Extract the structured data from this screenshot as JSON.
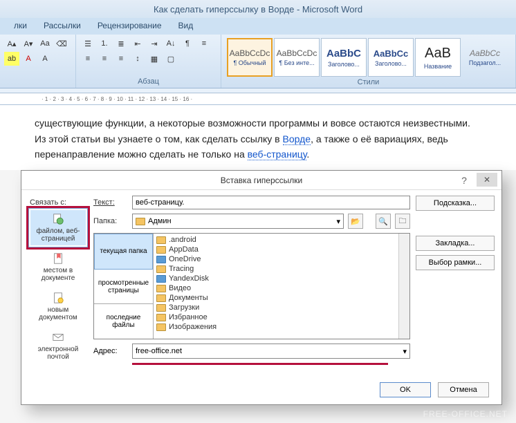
{
  "window": {
    "title": "Как сделать гиперссылку в Ворде - Microsoft Word"
  },
  "tabs": {
    "t1": "лки",
    "t2": "Рассылки",
    "t3": "Рецензирование",
    "t4": "Вид"
  },
  "ribbon": {
    "para_label": "Абзац",
    "styles_label": "Стили",
    "styles": [
      {
        "preview": "AaBbCcDc",
        "name": "¶ Обычный"
      },
      {
        "preview": "AaBbCcDc",
        "name": "¶ Без инте..."
      },
      {
        "preview": "AaBbC",
        "name": "Заголово..."
      },
      {
        "preview": "AaBbCc",
        "name": "Заголово..."
      },
      {
        "preview": "АаВ",
        "name": "Название"
      },
      {
        "preview": "AaBbCc",
        "name": "Подзагол..."
      }
    ]
  },
  "doc": {
    "p1a": "существующие функции, а некоторые возможности программы и вовсе остаются неизвестными.",
    "p2a": "Из этой статьи вы узнаете о том, как сделать ссылку в ",
    "p2link1": "Ворде",
    "p2b": ", а также о её вариациях, ведь перенаправление можно сделать не только на ",
    "p2link2": "веб-страницу",
    "p2c": "."
  },
  "dialog": {
    "title": "Вставка гиперссылки",
    "help": "?",
    "close": "✕",
    "link_with": "Связать с:",
    "text_label": "Текст:",
    "text_value": "веб-страницу.",
    "hint_btn": "Подсказка...",
    "left": {
      "file_web": "файлом, веб-страницей",
      "place_doc": "местом в документе",
      "new_doc": "новым документом",
      "email": "электронной почтой"
    },
    "folder_label": "Папка:",
    "folder_value": "Админ",
    "browse_tabs": {
      "current": "текущая папка",
      "browsed": "просмотренные страницы",
      "recent": "последние файлы"
    },
    "files": [
      ".android",
      "AppData",
      "OneDrive",
      "Tracing",
      "YandexDisk",
      "Видео",
      "Документы",
      "Загрузки",
      "Избранное",
      "Изображения"
    ],
    "address_label": "Адрес:",
    "address_value": "free-office.net",
    "right": {
      "bookmark": "Закладка...",
      "frame": "Выбор рамки..."
    },
    "ok": "OK",
    "cancel": "Отмена"
  },
  "watermark": "FREE-OFFICE.NET"
}
